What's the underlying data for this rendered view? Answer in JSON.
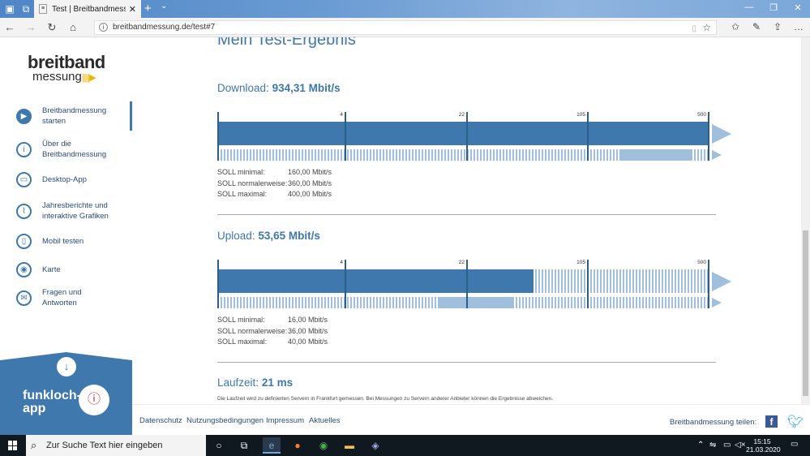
{
  "browser": {
    "tab_title": "Test | Breitbandmessung",
    "url": "breitbandmessung.de/test#7"
  },
  "sidebar": {
    "logo_line1": "breitband",
    "logo_line2": "messung",
    "items": [
      {
        "label": "Breitbandmessung starten",
        "icon": "play-icon"
      },
      {
        "label": "Über die Breitbandmessung",
        "icon": "info-icon"
      },
      {
        "label": "Desktop-App",
        "icon": "desktop-icon"
      },
      {
        "label": "Jahresberichte und interaktive Grafiken",
        "icon": "chart-icon"
      },
      {
        "label": "Mobil testen",
        "icon": "mobile-icon"
      },
      {
        "label": "Karte",
        "icon": "map-icon"
      },
      {
        "label": "Fragen und Antworten",
        "icon": "chat-icon"
      }
    ],
    "funkloch_text": "funkloch-app"
  },
  "main": {
    "heading": "Mein Test-Ergebnis",
    "download": {
      "label": "Download:",
      "value": "934,31 Mbit/s",
      "ticks": [
        "4",
        "22",
        "105",
        "500"
      ],
      "soll": [
        {
          "k": "SOLL minimal:",
          "v": "160,00 Mbit/s"
        },
        {
          "k": "SOLL normalerweise:",
          "v": "360,00 Mbit/s"
        },
        {
          "k": "SOLL maximal:",
          "v": "400,00 Mbit/s"
        }
      ]
    },
    "upload": {
      "label": "Upload:",
      "value": "53,65 Mbit/s",
      "ticks": [
        "4",
        "22",
        "105",
        "500"
      ],
      "soll": [
        {
          "k": "SOLL minimal:",
          "v": "16,00 Mbit/s"
        },
        {
          "k": "SOLL normalerweise:",
          "v": "36,00 Mbit/s"
        },
        {
          "k": "SOLL maximal:",
          "v": "40,00 Mbit/s"
        }
      ]
    },
    "laufzeit_label": "Laufzeit:",
    "laufzeit_value": "21 ms",
    "note": "Die Laufzeit wird zu definierten Servern in Frankfurt gemessen. Bei Messungen zu Servern anderer Anbieter können die Ergebnisse abweichen."
  },
  "footer": {
    "links": [
      "Datenschutz",
      "Nutzungsbedingungen",
      "Impressum",
      "Aktuelles"
    ],
    "share": "Breitbandmessung teilen:"
  },
  "taskbar": {
    "search_placeholder": "Zur Suche Text hier eingeben",
    "time": "15:15",
    "date": "21.03.2020"
  }
}
